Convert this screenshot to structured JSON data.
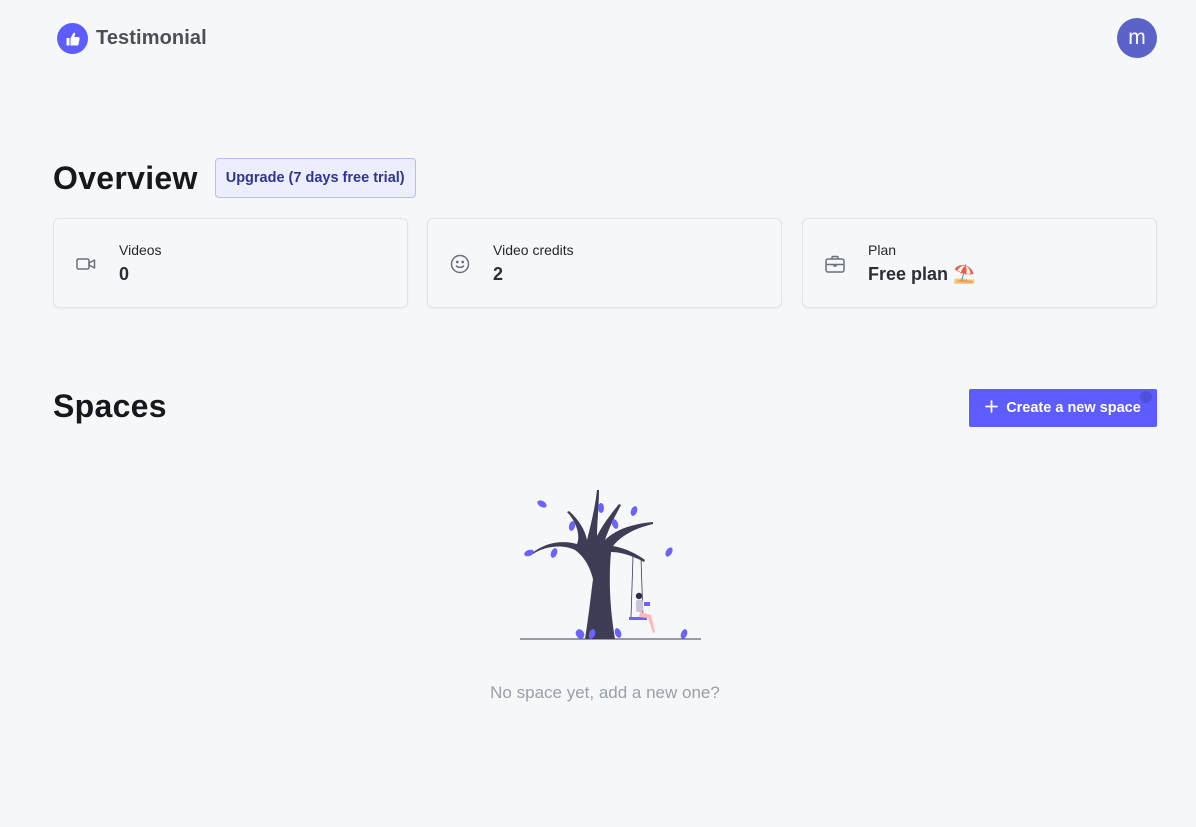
{
  "header": {
    "brand_name": "Testimonial",
    "avatar_initial": "m"
  },
  "overview": {
    "title": "Overview",
    "upgrade_label": "Upgrade (7 days free trial)",
    "cards": [
      {
        "label": "Videos",
        "value": "0",
        "icon": "video-camera-icon"
      },
      {
        "label": "Video credits",
        "value": "2",
        "icon": "smiley-face-icon"
      },
      {
        "label": "Plan",
        "value": "Free plan ⛱️",
        "icon": "briefcase-icon"
      }
    ]
  },
  "spaces": {
    "title": "Spaces",
    "create_label": "Create a new space",
    "empty_text": "No space yet, add a new one?"
  },
  "colors": {
    "accent": "#5d5dff",
    "avatar": "#5b63c9",
    "background": "#f5f7f8"
  }
}
